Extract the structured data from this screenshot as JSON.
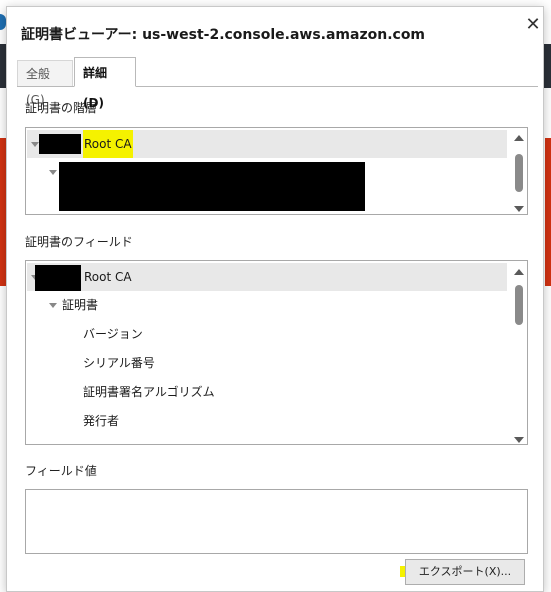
{
  "dialog": {
    "title": "証明書ビューアー: us-west-2.console.aws.amazon.com",
    "close_symbol": "✕"
  },
  "tabs": [
    {
      "label": "全般(G)",
      "active": false
    },
    {
      "label": "詳細(D)",
      "active": true
    }
  ],
  "hierarchy": {
    "label": "証明書の階層",
    "items": [
      {
        "label": "Root CA",
        "highlighted": true
      }
    ]
  },
  "fields": {
    "label": "証明書のフィールド",
    "items": [
      {
        "label": "Root CA"
      },
      {
        "label": "証明書"
      },
      {
        "label": "バージョン"
      },
      {
        "label": "シリアル番号"
      },
      {
        "label": "証明書署名アルゴリズム"
      },
      {
        "label": "発行者"
      }
    ]
  },
  "field_value": {
    "label": "フィールド値",
    "value": ""
  },
  "export_button": {
    "label": "エクスポート(X)..."
  },
  "colors": {
    "highlight": "#f5f200",
    "selection": "#e8e8e8",
    "border": "#a8a8a8"
  }
}
